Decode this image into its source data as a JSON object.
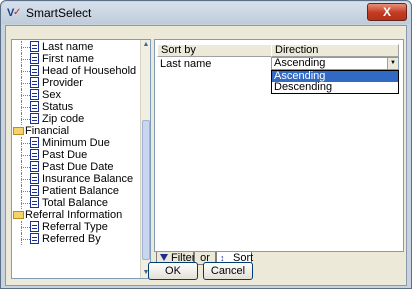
{
  "window": {
    "title": "SmartSelect",
    "close_label": "X"
  },
  "tree": {
    "items": [
      {
        "label": "Last name",
        "kind": "child"
      },
      {
        "label": "First name",
        "kind": "child"
      },
      {
        "label": "Head of Household",
        "kind": "child"
      },
      {
        "label": "Provider",
        "kind": "child"
      },
      {
        "label": "Sex",
        "kind": "child"
      },
      {
        "label": "Status",
        "kind": "child"
      },
      {
        "label": "Zip code",
        "kind": "child"
      },
      {
        "label": "Financial",
        "kind": "folder"
      },
      {
        "label": "Minimum Due",
        "kind": "child"
      },
      {
        "label": "Past Due",
        "kind": "child"
      },
      {
        "label": "Past Due Date",
        "kind": "child"
      },
      {
        "label": "Insurance Balance",
        "kind": "child"
      },
      {
        "label": "Patient Balance",
        "kind": "child"
      },
      {
        "label": "Total Balance",
        "kind": "child"
      },
      {
        "label": "Referral Information",
        "kind": "folder"
      },
      {
        "label": "Referral Type",
        "kind": "child"
      },
      {
        "label": "Referred By",
        "kind": "child"
      }
    ]
  },
  "grid": {
    "headers": {
      "sort_by": "Sort by",
      "direction": "Direction"
    },
    "row": {
      "sort_by": "Last name",
      "direction": "Ascending"
    },
    "options": [
      "Ascending",
      "Descending"
    ],
    "selected_option": "Ascending"
  },
  "tabs": {
    "filter": "Filter",
    "or": "or",
    "sort": "Sort"
  },
  "buttons": {
    "ok": "OK",
    "cancel": "Cancel"
  },
  "colors": {
    "selection": "#316ac5",
    "title_bar": "#c9d3df",
    "close": "#c33a20"
  }
}
